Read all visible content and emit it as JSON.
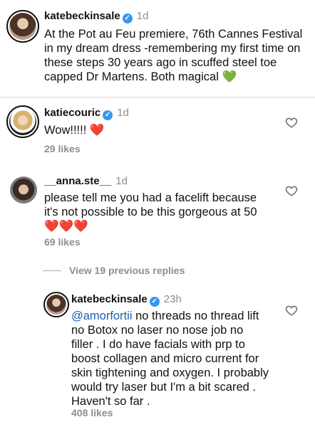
{
  "post_caption": {
    "username": "katebeckinsale",
    "time": "1d",
    "text_lines": [
      "At the Pot au Feu premiere, 76th Cannes Festival",
      "in my dream dress -remembering my first time on",
      "these steps 30 years ago in scuffed steel toe",
      "capped Dr Martens. Both magical"
    ],
    "emoji": "💚"
  },
  "comments": [
    {
      "username": "katiecouric",
      "time": "1d",
      "text": "Wow!!!!!",
      "emoji": "❤️",
      "likes": "29 likes"
    },
    {
      "username": "__anna.ste__",
      "time": "1d",
      "text_lines": [
        "please tell me you had a facelift because",
        "it's not possible to be this gorgeous at 50"
      ],
      "emoji": "❤️❤️❤️",
      "likes": "69 likes"
    }
  ],
  "view_replies": "View 19 previous replies",
  "reply": {
    "username": "katebeckinsale",
    "time": "23h",
    "mention": "@amorfortii",
    "text_first_line_rest": " no threads no thread lift",
    "text_lines": [
      "no Botox no laser no nose job no",
      "filler . I do have facials with prp to",
      "boost collagen and micro current for",
      "skin tightening and oxygen. I probably",
      "would try laser but I'm a bit scared .",
      "Haven't so far ."
    ],
    "likes": "408 likes"
  },
  "colors": {
    "verified": "#3797f0",
    "secondary_text": "#8e8e8e",
    "mention": "#1a5ea8"
  }
}
